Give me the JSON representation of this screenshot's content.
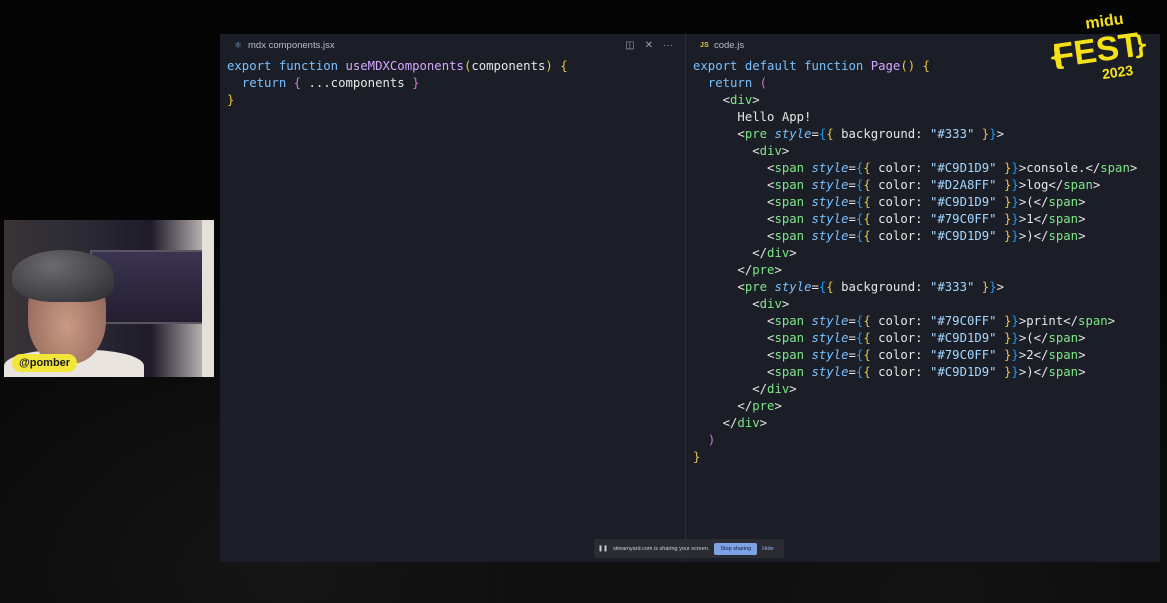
{
  "editor": {
    "left_pane": {
      "tab_label": "mdx components.jsx",
      "tab_icon": "mdx-file-icon",
      "actions": [
        {
          "glyph": "◫",
          "name": "split-editor-icon"
        },
        {
          "glyph": "✕",
          "name": "close-icon"
        },
        {
          "glyph": "···",
          "name": "more-actions-icon"
        }
      ]
    },
    "right_pane": {
      "tab_label": "code.js",
      "tab_icon": "JS"
    }
  },
  "webcam": {
    "handle": "@pomber"
  },
  "sharebar": {
    "message": "streamyard.com is sharing your screen.",
    "stop_label": "Stop sharing",
    "hide_label": "Hide"
  },
  "logo": {
    "top": "midu",
    "main": "FEST",
    "year": "2023"
  },
  "colors": {
    "editor_bg": "#1b1e26",
    "badge_bg": "#f2e63a",
    "logo_yellow": "#f5e216",
    "stop_button": "#7ea2e6"
  },
  "code_left": [
    [
      [
        "k",
        "export "
      ],
      [
        "k",
        "function "
      ],
      [
        "f",
        "useMDXComponents"
      ],
      [
        "b1",
        "("
      ],
      [
        "p",
        "components"
      ],
      [
        "b1",
        ")"
      ],
      [
        "p",
        " "
      ],
      [
        "b1",
        "{"
      ]
    ],
    [
      [
        "p",
        "  "
      ],
      [
        "k",
        "return "
      ],
      [
        "b2",
        "{"
      ],
      [
        "p",
        " ...components "
      ],
      [
        "b2",
        "}"
      ]
    ],
    [
      [
        "b1",
        "}"
      ]
    ]
  ],
  "code_right": [
    [
      [
        "k",
        "export "
      ],
      [
        "k",
        "default "
      ],
      [
        "k",
        "function "
      ],
      [
        "f",
        "Page"
      ],
      [
        "b1",
        "()"
      ],
      [
        "p",
        " "
      ],
      [
        "b1",
        "{"
      ]
    ],
    [
      [
        "p",
        "  "
      ],
      [
        "k",
        "return "
      ],
      [
        "b2",
        "("
      ]
    ],
    [
      [
        "p",
        "    <"
      ],
      [
        "t",
        "div"
      ],
      [
        "p",
        ">"
      ]
    ],
    [
      [
        "txt",
        "      Hello App!"
      ]
    ],
    [
      [
        "p",
        "      <"
      ],
      [
        "t",
        "pre "
      ],
      [
        "at",
        "style"
      ],
      [
        "p",
        "="
      ],
      [
        "b3",
        "{"
      ],
      [
        "b1",
        "{"
      ],
      [
        "p",
        " background: "
      ],
      [
        "s",
        "\"#333\""
      ],
      [
        "p",
        " "
      ],
      [
        "b1",
        "}"
      ],
      [
        "b3",
        "}"
      ],
      [
        "p",
        ">"
      ]
    ],
    [
      [
        "p",
        "        <"
      ],
      [
        "t",
        "div"
      ],
      [
        "p",
        ">"
      ]
    ],
    [
      [
        "p",
        "          <"
      ],
      [
        "t",
        "span "
      ],
      [
        "at",
        "style"
      ],
      [
        "p",
        "="
      ],
      [
        "b3",
        "{"
      ],
      [
        "b1",
        "{"
      ],
      [
        "p",
        " color: "
      ],
      [
        "s",
        "\"#C9D1D9\""
      ],
      [
        "p",
        " "
      ],
      [
        "b1",
        "}"
      ],
      [
        "b3",
        "}"
      ],
      [
        "p",
        ">console.</"
      ],
      [
        "t",
        "span"
      ],
      [
        "p",
        ">"
      ]
    ],
    [
      [
        "p",
        "          <"
      ],
      [
        "t",
        "span "
      ],
      [
        "at",
        "style"
      ],
      [
        "p",
        "="
      ],
      [
        "b3",
        "{"
      ],
      [
        "b1",
        "{"
      ],
      [
        "p",
        " color: "
      ],
      [
        "s",
        "\"#D2A8FF\""
      ],
      [
        "p",
        " "
      ],
      [
        "b1",
        "}"
      ],
      [
        "b3",
        "}"
      ],
      [
        "p",
        ">log</"
      ],
      [
        "t",
        "span"
      ],
      [
        "p",
        ">"
      ]
    ],
    [
      [
        "p",
        "          <"
      ],
      [
        "t",
        "span "
      ],
      [
        "at",
        "style"
      ],
      [
        "p",
        "="
      ],
      [
        "b3",
        "{"
      ],
      [
        "b1",
        "{"
      ],
      [
        "p",
        " color: "
      ],
      [
        "s",
        "\"#C9D1D9\""
      ],
      [
        "p",
        " "
      ],
      [
        "b1",
        "}"
      ],
      [
        "b3",
        "}"
      ],
      [
        "p",
        ">(</"
      ],
      [
        "t",
        "span"
      ],
      [
        "p",
        ">"
      ]
    ],
    [
      [
        "p",
        "          <"
      ],
      [
        "t",
        "span "
      ],
      [
        "at",
        "style"
      ],
      [
        "p",
        "="
      ],
      [
        "b3",
        "{"
      ],
      [
        "b1",
        "{"
      ],
      [
        "p",
        " color: "
      ],
      [
        "s",
        "\"#79C0FF\""
      ],
      [
        "p",
        " "
      ],
      [
        "b1",
        "}"
      ],
      [
        "b3",
        "}"
      ],
      [
        "p",
        ">1</"
      ],
      [
        "t",
        "span"
      ],
      [
        "p",
        ">"
      ]
    ],
    [
      [
        "p",
        "          <"
      ],
      [
        "t",
        "span "
      ],
      [
        "at",
        "style"
      ],
      [
        "p",
        "="
      ],
      [
        "b3",
        "{"
      ],
      [
        "b1",
        "{"
      ],
      [
        "p",
        " color: "
      ],
      [
        "s",
        "\"#C9D1D9\""
      ],
      [
        "p",
        " "
      ],
      [
        "b1",
        "}"
      ],
      [
        "b3",
        "}"
      ],
      [
        "p",
        ">)</"
      ],
      [
        "t",
        "span"
      ],
      [
        "p",
        ">"
      ]
    ],
    [
      [
        "p",
        "        </"
      ],
      [
        "t",
        "div"
      ],
      [
        "p",
        ">"
      ]
    ],
    [
      [
        "p",
        "      </"
      ],
      [
        "t",
        "pre"
      ],
      [
        "p",
        ">"
      ]
    ],
    [
      [
        "p",
        "      <"
      ],
      [
        "t",
        "pre "
      ],
      [
        "at",
        "style"
      ],
      [
        "p",
        "="
      ],
      [
        "b3",
        "{"
      ],
      [
        "b1",
        "{"
      ],
      [
        "p",
        " background: "
      ],
      [
        "s",
        "\"#333\""
      ],
      [
        "p",
        " "
      ],
      [
        "b1",
        "}"
      ],
      [
        "b3",
        "}"
      ],
      [
        "p",
        ">"
      ]
    ],
    [
      [
        "p",
        "        <"
      ],
      [
        "t",
        "div"
      ],
      [
        "p",
        ">"
      ]
    ],
    [
      [
        "p",
        "          <"
      ],
      [
        "t",
        "span "
      ],
      [
        "at",
        "style"
      ],
      [
        "p",
        "="
      ],
      [
        "b3",
        "{"
      ],
      [
        "b1",
        "{"
      ],
      [
        "p",
        " color: "
      ],
      [
        "s",
        "\"#79C0FF\""
      ],
      [
        "p",
        " "
      ],
      [
        "b1",
        "}"
      ],
      [
        "b3",
        "}"
      ],
      [
        "p",
        ">print</"
      ],
      [
        "t",
        "span"
      ],
      [
        "p",
        ">"
      ]
    ],
    [
      [
        "p",
        "          <"
      ],
      [
        "t",
        "span "
      ],
      [
        "at",
        "style"
      ],
      [
        "p",
        "="
      ],
      [
        "b3",
        "{"
      ],
      [
        "b1",
        "{"
      ],
      [
        "p",
        " color: "
      ],
      [
        "s",
        "\"#C9D1D9\""
      ],
      [
        "p",
        " "
      ],
      [
        "b1",
        "}"
      ],
      [
        "b3",
        "}"
      ],
      [
        "p",
        ">(</"
      ],
      [
        "t",
        "span"
      ],
      [
        "p",
        ">"
      ]
    ],
    [
      [
        "p",
        "          <"
      ],
      [
        "t",
        "span "
      ],
      [
        "at",
        "style"
      ],
      [
        "p",
        "="
      ],
      [
        "b3",
        "{"
      ],
      [
        "b1",
        "{"
      ],
      [
        "p",
        " color: "
      ],
      [
        "s",
        "\"#79C0FF\""
      ],
      [
        "p",
        " "
      ],
      [
        "b1",
        "}"
      ],
      [
        "b3",
        "}"
      ],
      [
        "p",
        ">2</"
      ],
      [
        "t",
        "span"
      ],
      [
        "p",
        ">"
      ]
    ],
    [
      [
        "p",
        "          <"
      ],
      [
        "t",
        "span "
      ],
      [
        "at",
        "style"
      ],
      [
        "p",
        "="
      ],
      [
        "b3",
        "{"
      ],
      [
        "b1",
        "{"
      ],
      [
        "p",
        " color: "
      ],
      [
        "s",
        "\"#C9D1D9\""
      ],
      [
        "p",
        " "
      ],
      [
        "b1",
        "}"
      ],
      [
        "b3",
        "}"
      ],
      [
        "p",
        ">)</"
      ],
      [
        "t",
        "span"
      ],
      [
        "p",
        ">"
      ]
    ],
    [
      [
        "p",
        "        </"
      ],
      [
        "t",
        "div"
      ],
      [
        "p",
        ">"
      ]
    ],
    [
      [
        "p",
        "      </"
      ],
      [
        "t",
        "pre"
      ],
      [
        "p",
        ">"
      ]
    ],
    [
      [
        "p",
        "    </"
      ],
      [
        "t",
        "div"
      ],
      [
        "p",
        ">"
      ]
    ],
    [
      [
        "p",
        "  "
      ],
      [
        "b2",
        ")"
      ]
    ],
    [
      [
        "b1",
        "}"
      ]
    ]
  ]
}
